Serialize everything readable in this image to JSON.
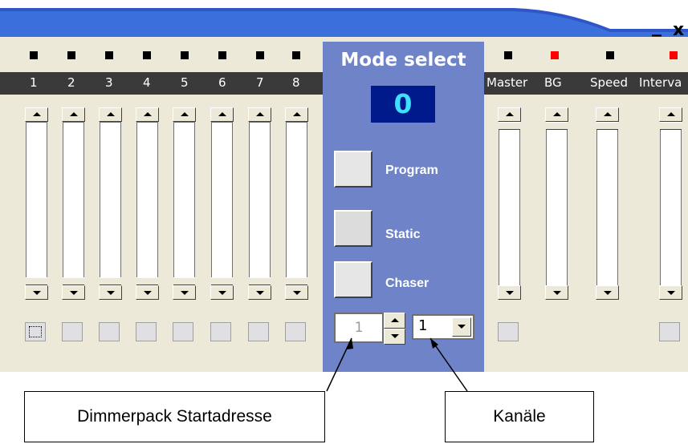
{
  "window": {
    "minimize_label": "_",
    "close_label": "x"
  },
  "leds": [
    {
      "color": "#000000"
    },
    {
      "color": "#000000"
    },
    {
      "color": "#000000"
    },
    {
      "color": "#000000"
    },
    {
      "color": "#000000"
    },
    {
      "color": "#000000"
    },
    {
      "color": "#000000"
    },
    {
      "color": "#000000"
    },
    {
      "color": "#000000"
    },
    {
      "color": "#ff0000"
    },
    {
      "color": "#000000"
    },
    {
      "color": "#ff0000"
    }
  ],
  "channels": [
    "1",
    "2",
    "3",
    "4",
    "5",
    "6",
    "7",
    "8"
  ],
  "extra_channels": [
    "Master",
    "BG",
    "Speed",
    "Interva"
  ],
  "mode_panel": {
    "title": "Mode select",
    "display_value": "0",
    "buttons": {
      "program": "Program",
      "static": "Static",
      "chaser": "Chaser"
    },
    "address_value": "1",
    "channel_count_value": "1"
  },
  "callouts": {
    "start_address": "Dimmerpack Startadresse",
    "channels": "Kanäle"
  },
  "colors": {
    "panel": "#6f84c8",
    "display_bg": "#001a8c",
    "display_text": "#3ee0ff",
    "label_bar": "#3a3a3a"
  }
}
